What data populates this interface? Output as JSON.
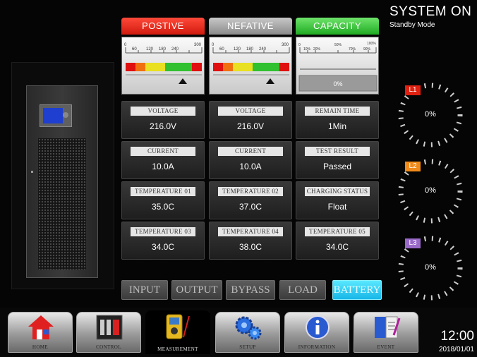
{
  "status": {
    "title": "SYSTEM ON",
    "mode": "Standby Mode",
    "time": "12:00",
    "date": "2018/01/01"
  },
  "columns": [
    {
      "header": "POSTIVE",
      "color": "#e8281a",
      "scale": [
        "0",
        "60",
        "120",
        "180",
        "240",
        "300"
      ],
      "cells": [
        {
          "label": "VOLTAGE",
          "value": "216.0V"
        },
        {
          "label": "CURRENT",
          "value": "10.0A"
        },
        {
          "label": "TEMPERATURE 01",
          "value": "35.0C"
        },
        {
          "label": "TEMPERATURE 03",
          "value": "34.0C"
        }
      ]
    },
    {
      "header": "NEFATIVE",
      "color": "#a8a8a8",
      "scale": [
        "0",
        "60",
        "120",
        "180",
        "240",
        "300"
      ],
      "cells": [
        {
          "label": "VOLTAGE",
          "value": "216.0V"
        },
        {
          "label": "CURRENT",
          "value": "10.0A"
        },
        {
          "label": "TEMPERATURE 02",
          "value": "37.0C"
        },
        {
          "label": "TEMPERATURE 04",
          "value": "38.0C"
        }
      ]
    },
    {
      "header": "CAPACITY",
      "color": "#34c030",
      "scale": [
        "0",
        "10%",
        "20%",
        "50%",
        "70%",
        "90%",
        "100%"
      ],
      "capacity": "0%",
      "cells": [
        {
          "label": "REMAIN TIME",
          "value": "1Min"
        },
        {
          "label": "TEST RESULT",
          "value": "Passed"
        },
        {
          "label": "CHARGING STATUS",
          "value": "Float"
        },
        {
          "label": "TEMPERATURE 05",
          "value": "34.0C"
        }
      ]
    }
  ],
  "phases": [
    {
      "label": "L1",
      "value": "0%",
      "color": "#e02010"
    },
    {
      "label": "L2",
      "value": "0%",
      "color": "#f08a1a"
    },
    {
      "label": "L3",
      "value": "0%",
      "color": "#9a6ac8"
    }
  ],
  "subtabs": [
    "INPUT",
    "OUTPUT",
    "BYPASS",
    "LOAD",
    "BATTERY"
  ],
  "active_subtab": "BATTERY",
  "nav": [
    {
      "label": "HOME",
      "icon": "home-icon"
    },
    {
      "label": "CONTROL",
      "icon": "control-icon"
    },
    {
      "label": "MEASUREMENT",
      "icon": "multimeter-icon"
    },
    {
      "label": "SETUP",
      "icon": "gears-icon"
    },
    {
      "label": "INFORMATION",
      "icon": "info-icon"
    },
    {
      "label": "EVENT",
      "icon": "event-log-icon"
    }
  ]
}
